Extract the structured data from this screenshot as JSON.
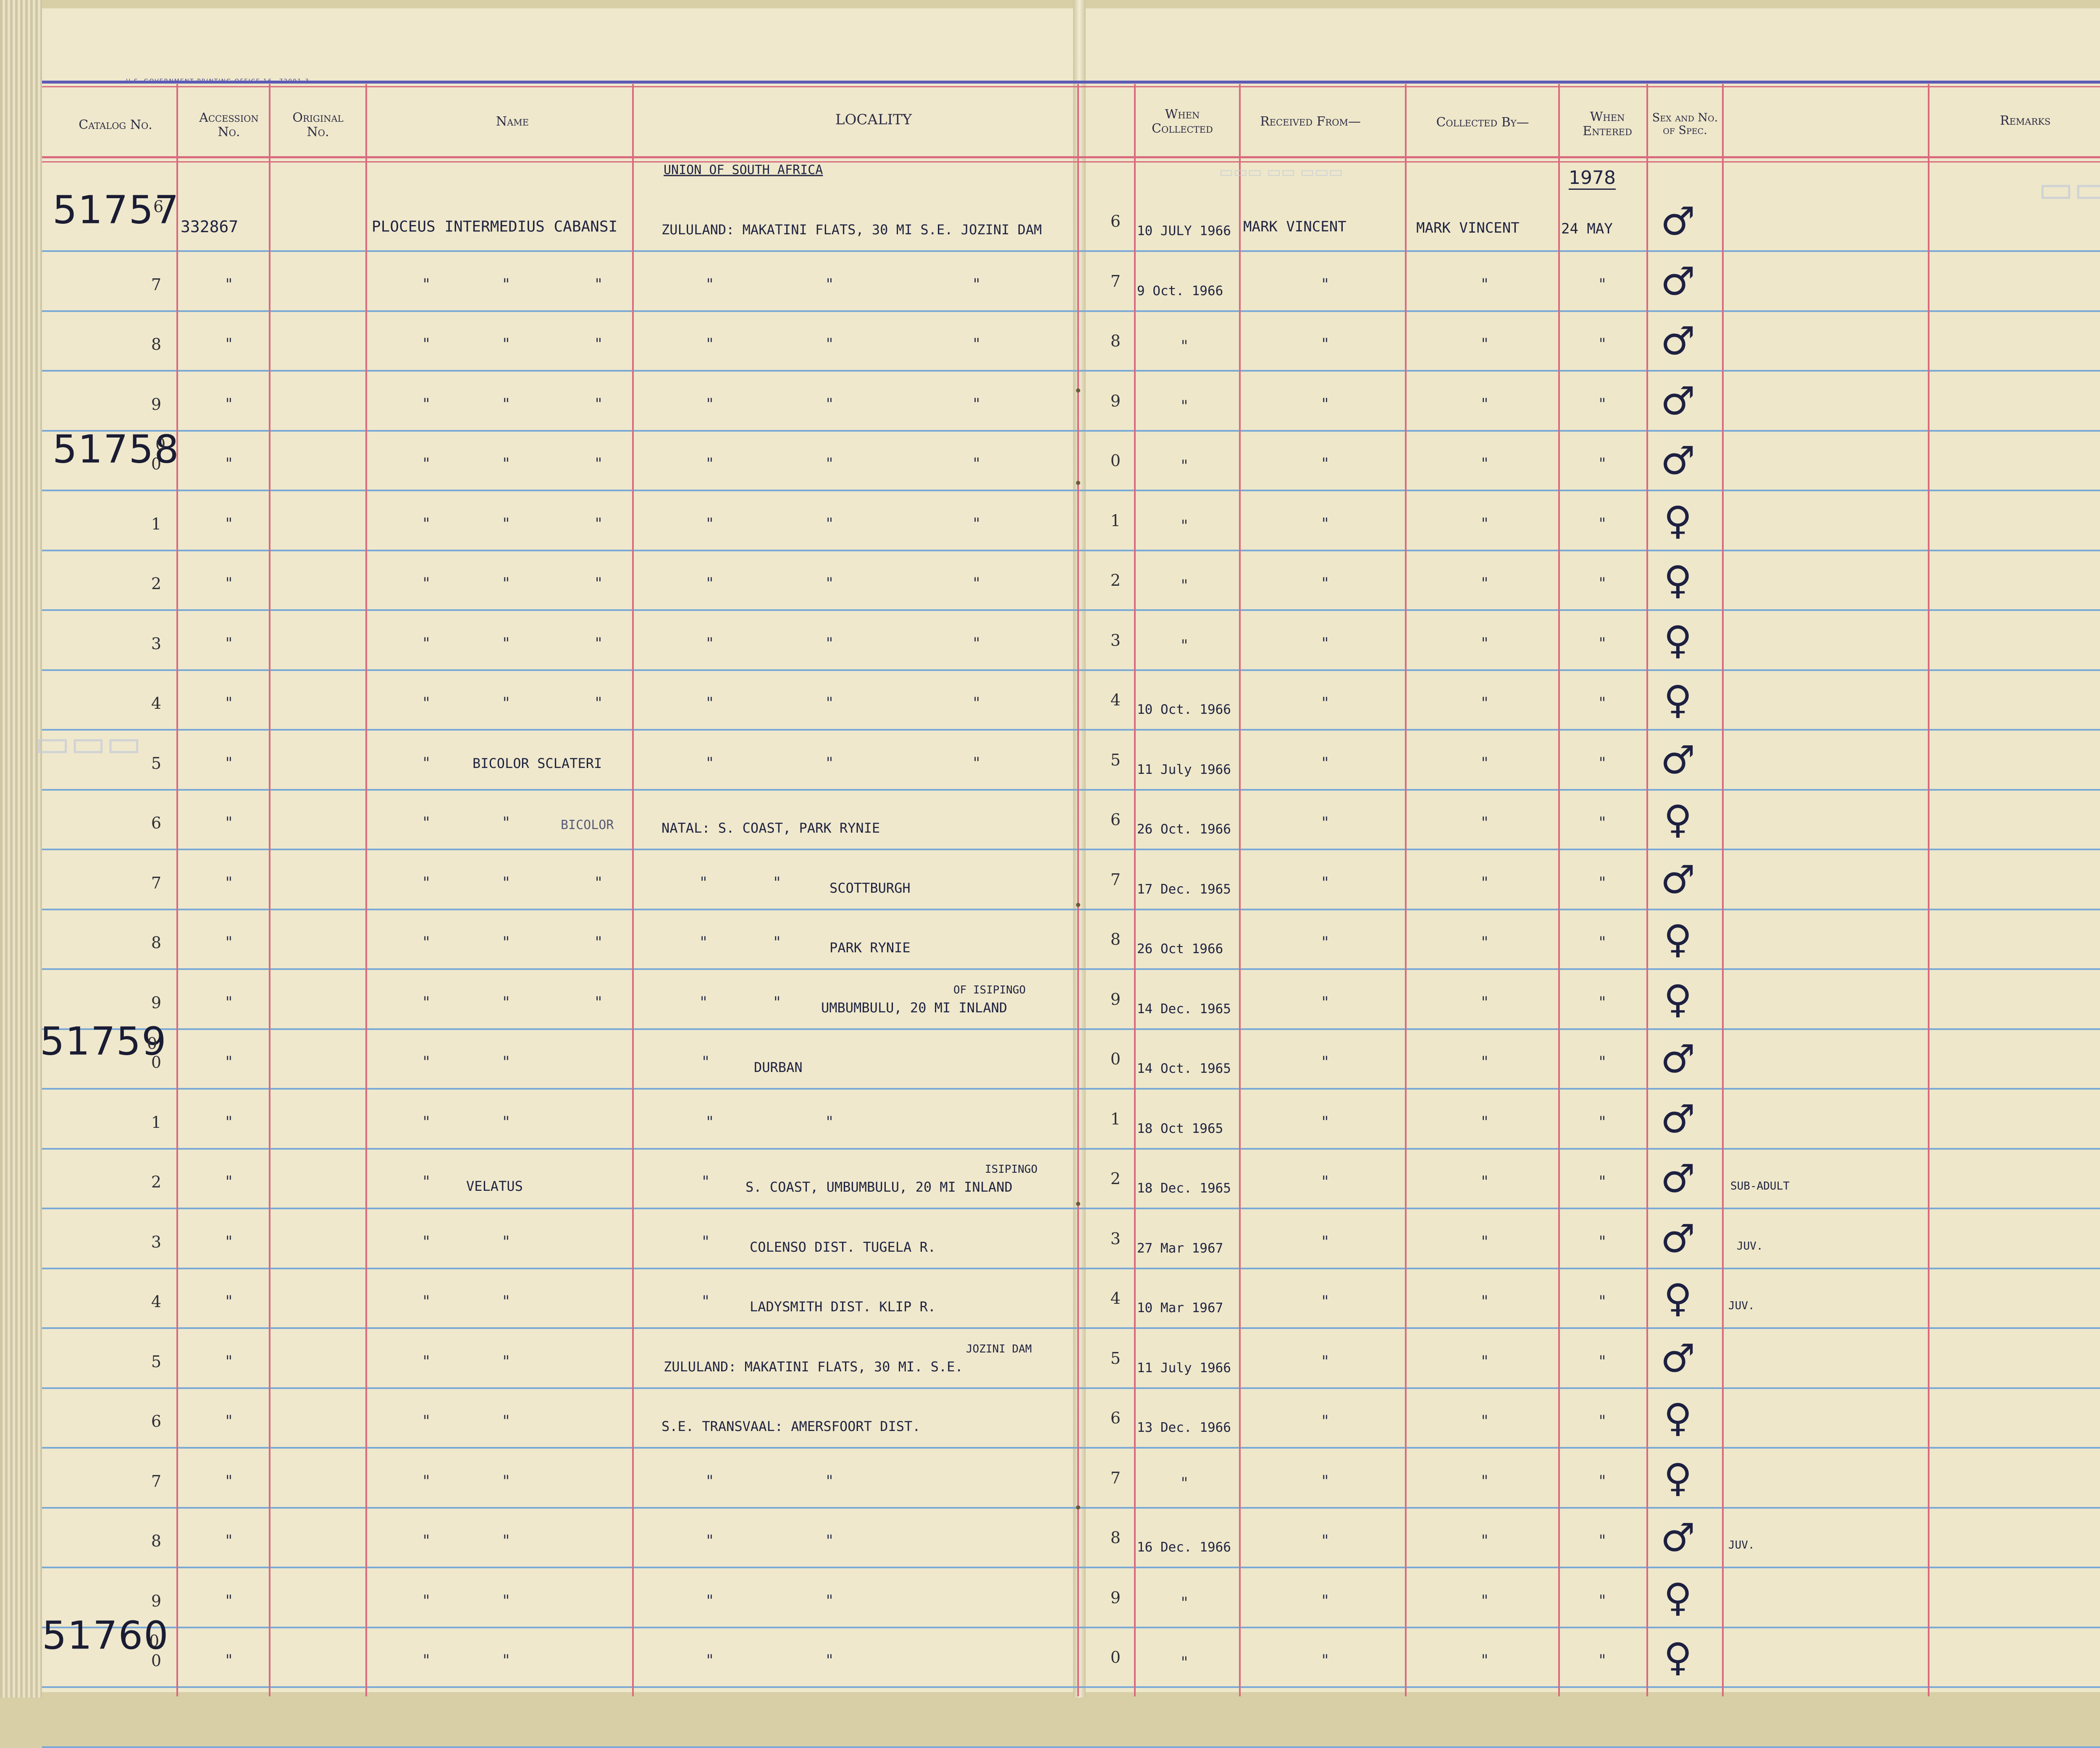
{
  "printer_line": "U.S. GOVERNMENT PRINTING OFFICE   16—72091-3",
  "headers": {
    "catalog": "Catalog No.",
    "accession": "Accession No.",
    "original": "Original No.",
    "name": "Name",
    "locality": "LOCALITY",
    "when_collected": "When Collected",
    "received_from": "Received From—",
    "collected_by": "Collected By—",
    "when_entered": "When Entered",
    "sex": "Sex and No. of Spec.",
    "remarks": "Remarks"
  },
  "locality_heading": "UNION OF SOUTH AFRICA",
  "entered_year": "1978",
  "catalog_groups": [
    {
      "number": "51757",
      "first_digit": "6"
    },
    {
      "number": "51758",
      "first_digit": "0"
    },
    {
      "number": "51759",
      "first_digit": "0"
    },
    {
      "number": "51760",
      "first_digit": "0"
    }
  ],
  "rows": [
    {
      "n": "6",
      "acc": "332867",
      "name": "PLOCEUS  INTERMEDIUS  CABANSI",
      "loc": "ZULULAND: MAKATINI FLATS, 30 MI S.E. JOZINI DAM",
      "date": "10 JULY 1966",
      "recv": "MARK VINCENT",
      "coll": "MARK VINCENT",
      "entered": "24 MAY",
      "sex": "♂",
      "rem": ""
    },
    {
      "n": "7",
      "acc": "\"",
      "name": "",
      "loc": "",
      "date": "9 Oct. 1966",
      "recv": "",
      "coll": "",
      "entered": "",
      "sex": "♂",
      "rem": ""
    },
    {
      "n": "8",
      "acc": "",
      "name": "",
      "loc": "",
      "date": "\"",
      "recv": "",
      "coll": "",
      "entered": "",
      "sex": "♂",
      "rem": ""
    },
    {
      "n": "9",
      "acc": "",
      "name": "",
      "loc": "",
      "date": "\"",
      "recv": "",
      "coll": "",
      "entered": "",
      "sex": "♂",
      "rem": ""
    },
    {
      "n": "0",
      "acc": "",
      "name": "",
      "loc": "",
      "date": "\"",
      "recv": "",
      "coll": "",
      "entered": "",
      "sex": "♂",
      "rem": ""
    },
    {
      "n": "1",
      "acc": "",
      "name": "",
      "loc": "",
      "date": "\"",
      "recv": "",
      "coll": "",
      "entered": "",
      "sex": "♀",
      "rem": ""
    },
    {
      "n": "2",
      "acc": "",
      "name": "",
      "loc": "",
      "date": "\"",
      "recv": "",
      "coll": "",
      "entered": "",
      "sex": "♀",
      "rem": ""
    },
    {
      "n": "3",
      "acc": "",
      "name": "",
      "loc": "",
      "date": "\"",
      "recv": "",
      "coll": "",
      "entered": "",
      "sex": "♀",
      "rem": ""
    },
    {
      "n": "4",
      "acc": "",
      "name": "",
      "loc": "",
      "date": "10 Oct. 1966",
      "recv": "",
      "coll": "",
      "entered": "",
      "sex": "♀",
      "rem": ""
    },
    {
      "n": "5",
      "acc": "",
      "name": "BICOLOR  SCLATERI",
      "loc": "",
      "date": "11 July 1966",
      "recv": "",
      "coll": "",
      "entered": "",
      "sex": "♂",
      "rem": ""
    },
    {
      "n": "6",
      "acc": "",
      "name": "BICOLOR",
      "loc": "NATAL: S. COAST, PARK RYNIE",
      "date": "26 Oct. 1966",
      "recv": "",
      "coll": "",
      "entered": "",
      "sex": "♀",
      "rem": ""
    },
    {
      "n": "7",
      "acc": "",
      "name": "",
      "loc": "SCOTTBURGH",
      "date": "17 Dec. 1965",
      "recv": "",
      "coll": "",
      "entered": "",
      "sex": "♂",
      "rem": ""
    },
    {
      "n": "8",
      "acc": "",
      "name": "",
      "loc": "PARK RYNIE",
      "date": "26 Oct 1966",
      "recv": "",
      "coll": "",
      "entered": "",
      "sex": "♀",
      "rem": ""
    },
    {
      "n": "9",
      "acc": "",
      "name": "",
      "loc": "UMBUMBULU, 20 MI INLAND",
      "loc_note": "OF ISIPINGO",
      "date": "14 Dec. 1965",
      "recv": "",
      "coll": "",
      "entered": "",
      "sex": "♀",
      "rem": ""
    },
    {
      "n": "0",
      "acc": "",
      "name": "",
      "loc": "DURBAN",
      "date": "14 Oct. 1965",
      "recv": "",
      "coll": "",
      "entered": "",
      "sex": "♂",
      "rem": ""
    },
    {
      "n": "1",
      "acc": "",
      "name": "",
      "loc": "",
      "date": "18 Oct 1965",
      "recv": "",
      "coll": "",
      "entered": "",
      "sex": "♂",
      "rem": ""
    },
    {
      "n": "2",
      "acc": "",
      "name": "VELATUS",
      "loc": "S. COAST, UMBUMBULU, 20 MI INLAND",
      "loc_note": "ISIPINGO",
      "date": "18 Dec. 1965",
      "recv": "",
      "coll": "",
      "entered": "",
      "sex": "♂",
      "rem": "SUB-ADULT"
    },
    {
      "n": "3",
      "acc": "",
      "name": "",
      "loc": "COLENSO DIST. TUGELA R.",
      "date": "27 Mar 1967",
      "recv": "",
      "coll": "",
      "entered": "",
      "sex": "♂",
      "rem": "JUV."
    },
    {
      "n": "4",
      "acc": "",
      "name": "",
      "loc": "LADYSMITH DIST. KLIP R.",
      "date": "10 Mar 1967",
      "recv": "",
      "coll": "",
      "entered": "",
      "sex": "♀",
      "rem": "JUV."
    },
    {
      "n": "5",
      "acc": "",
      "name": "",
      "loc": "ZULULAND: MAKATINI FLATS, 30 MI. S.E.",
      "loc_note": "JOZINI DAM",
      "date": "11 July 1966",
      "recv": "",
      "coll": "",
      "entered": "",
      "sex": "♂",
      "rem": ""
    },
    {
      "n": "6",
      "acc": "",
      "name": "",
      "loc": "S.E. TRANSVAAL: AMERSFOORT DIST.",
      "date": "13 Dec. 1966",
      "recv": "",
      "coll": "",
      "entered": "",
      "sex": "♀",
      "rem": ""
    },
    {
      "n": "7",
      "acc": "",
      "name": "",
      "loc": "",
      "date": "\"",
      "recv": "",
      "coll": "",
      "entered": "",
      "sex": "♀",
      "rem": ""
    },
    {
      "n": "8",
      "acc": "",
      "name": "",
      "loc": "",
      "date": "16 Dec. 1966",
      "recv": "",
      "coll": "",
      "entered": "",
      "sex": "♂",
      "rem": "JUV."
    },
    {
      "n": "9",
      "acc": "",
      "name": "",
      "loc": "",
      "date": "\"",
      "recv": "",
      "coll": "",
      "entered": "",
      "sex": "♀",
      "rem": ""
    },
    {
      "n": "0",
      "acc": "",
      "name": "",
      "loc": "",
      "date": "\"",
      "recv": "",
      "coll": "",
      "entered": "",
      "sex": "♀",
      "rem": ""
    }
  ],
  "ditto": "\"",
  "colors": {
    "blue_rule": "#7aa9d6",
    "red_rule": "#d96a7e",
    "ink": "#1f2340",
    "paper": "#efe8cc"
  }
}
